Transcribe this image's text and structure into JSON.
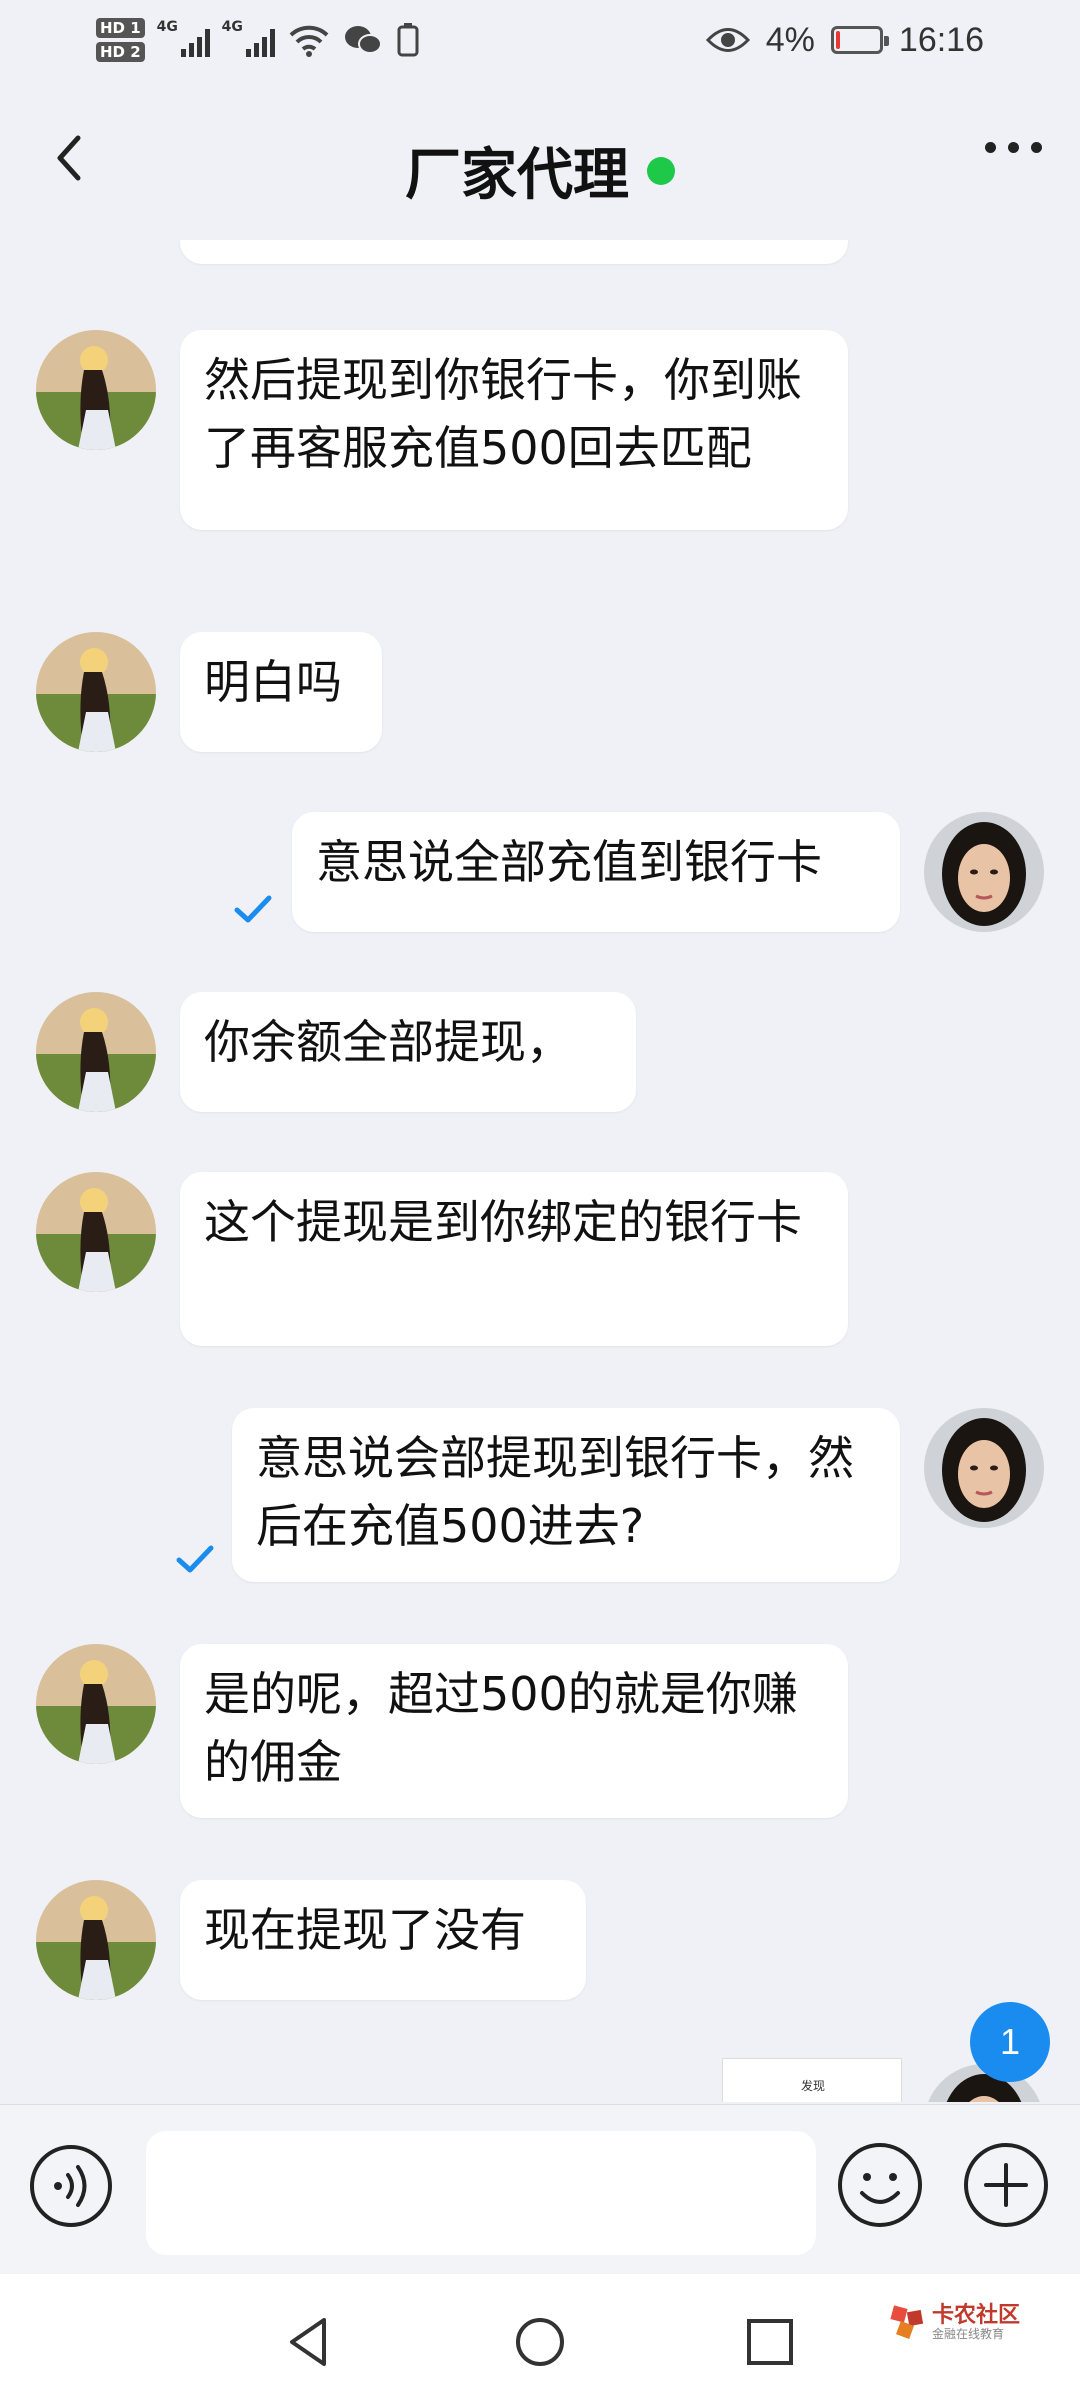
{
  "status_bar": {
    "hd1": "HD 1",
    "hd2": "HD 2",
    "net1": "4G",
    "net2": "4G",
    "battery_pct": "4%",
    "time": "16:16"
  },
  "header": {
    "title": "厂家代理",
    "online_color": "#1ec94a"
  },
  "messages": [
    {
      "side": "left",
      "text": "然后提现到你银行卡，你到账了再客服充值500回去匹配"
    },
    {
      "side": "left",
      "text": "明白吗"
    },
    {
      "side": "right",
      "text": "意思说全部充值到银行卡",
      "read": true
    },
    {
      "side": "left",
      "text": "你余额全部提现，"
    },
    {
      "side": "left",
      "text": "这个提现是到你绑定的银行卡"
    },
    {
      "side": "right",
      "text": "意思说会部提现到银行卡，然后在充值500进去?",
      "read": true
    },
    {
      "side": "left",
      "text": "是的呢，超过500的就是你赚的佣金"
    },
    {
      "side": "left",
      "text": "现在提现了没有"
    }
  ],
  "new_message_badge": "1",
  "thumbnail_text": "发现",
  "watermark": {
    "main": "卡农社区",
    "sub": "金融在线教育"
  },
  "colors": {
    "accent": "#1a8cf0",
    "check": "#1a8cf0",
    "background": "#eff1f6"
  }
}
